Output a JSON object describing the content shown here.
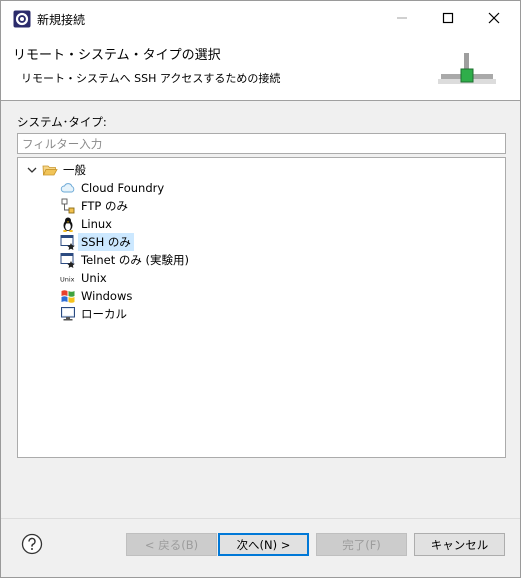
{
  "window": {
    "title": "新規接続"
  },
  "header": {
    "title": "リモート・システム・タイプの選択",
    "description": "リモート・システムへ SSH アクセスするための接続"
  },
  "system_type_label": "システム･タイプ:",
  "filter": {
    "placeholder": "フィルター入力",
    "value": ""
  },
  "tree": {
    "group": {
      "label": "一般",
      "expanded": true,
      "icon": "folder-open-icon"
    },
    "items": [
      {
        "label": "Cloud Foundry",
        "icon": "cloud-icon",
        "selected": false
      },
      {
        "label": "FTP のみ",
        "icon": "ftp-icon",
        "selected": false
      },
      {
        "label": "Linux",
        "icon": "linux-penguin-icon",
        "selected": false
      },
      {
        "label": "SSH のみ",
        "icon": "ssh-terminal-icon",
        "selected": true
      },
      {
        "label": "Telnet のみ (実験用)",
        "icon": "telnet-terminal-icon",
        "selected": false
      },
      {
        "label": "Unix",
        "icon": "unix-icon",
        "selected": false
      },
      {
        "label": "Windows",
        "icon": "windows-flag-icon",
        "selected": false
      },
      {
        "label": "ローカル",
        "icon": "local-computer-icon",
        "selected": false
      }
    ]
  },
  "buttons": {
    "back": "< 戻る(B)",
    "next": "次へ(N) >",
    "finish": "完了(F)",
    "cancel": "キャンセル"
  },
  "colors": {
    "selection": "#cce8ff",
    "default_button_border": "#0078d7",
    "folder": "#e8b64a"
  }
}
